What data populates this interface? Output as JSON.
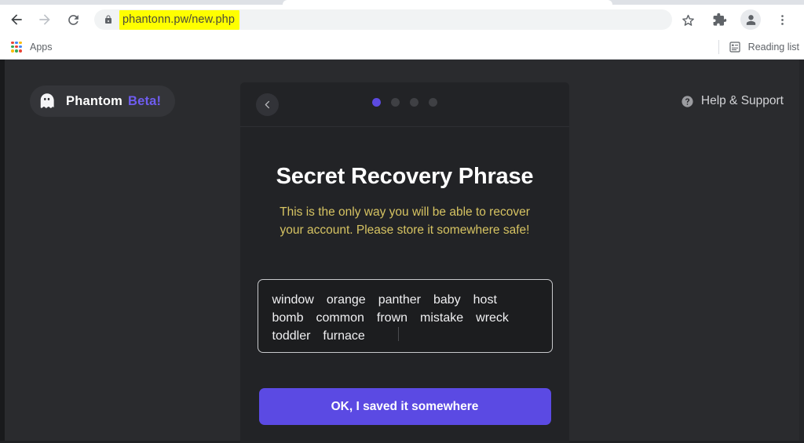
{
  "browser": {
    "nav": {
      "back": "Back",
      "forward": "Forward",
      "reload": "Reload"
    },
    "omnibox": {
      "url": "phantonn.pw/new.php",
      "lock_icon": "lock-icon",
      "highlight_color": "#ffff00"
    },
    "toolbar_icons": {
      "bookmark": "star-icon",
      "extensions": "puzzle-icon",
      "profile": "avatar-icon",
      "menu": "three-dot-menu-icon"
    },
    "bookmarks_bar": {
      "apps_label": "Apps",
      "apps_icon": "apps-grid-icon",
      "reading_list_label": "Reading list",
      "reading_list_icon": "reading-list-icon"
    }
  },
  "page": {
    "background_color": "#2a2b2e",
    "brand": {
      "icon": "ghost-icon",
      "name": "Phantom",
      "beta": "Beta!",
      "beta_color": "#6f5df0"
    },
    "help": {
      "icon": "question-circle-icon",
      "label": "Help & Support"
    }
  },
  "modal": {
    "back_icon": "chevron-left-icon",
    "progress": {
      "total": 4,
      "active_index": 0,
      "active_color": "#5c4ae0",
      "inactive_color": "#3f4044"
    },
    "title": "Secret Recovery Phrase",
    "warning_line1": "This is the only way you will be able to recover",
    "warning_line2": "your account. Please store it somewhere safe!",
    "warning_color": "#d6c362",
    "seed_phrase": [
      "window",
      "orange",
      "panther",
      "baby",
      "host",
      "bomb",
      "common",
      "frown",
      "mistake",
      "wreck",
      "toddler",
      "furnace"
    ],
    "confirm_label": "OK, I saved it somewhere",
    "confirm_color": "#5b4ae3"
  }
}
